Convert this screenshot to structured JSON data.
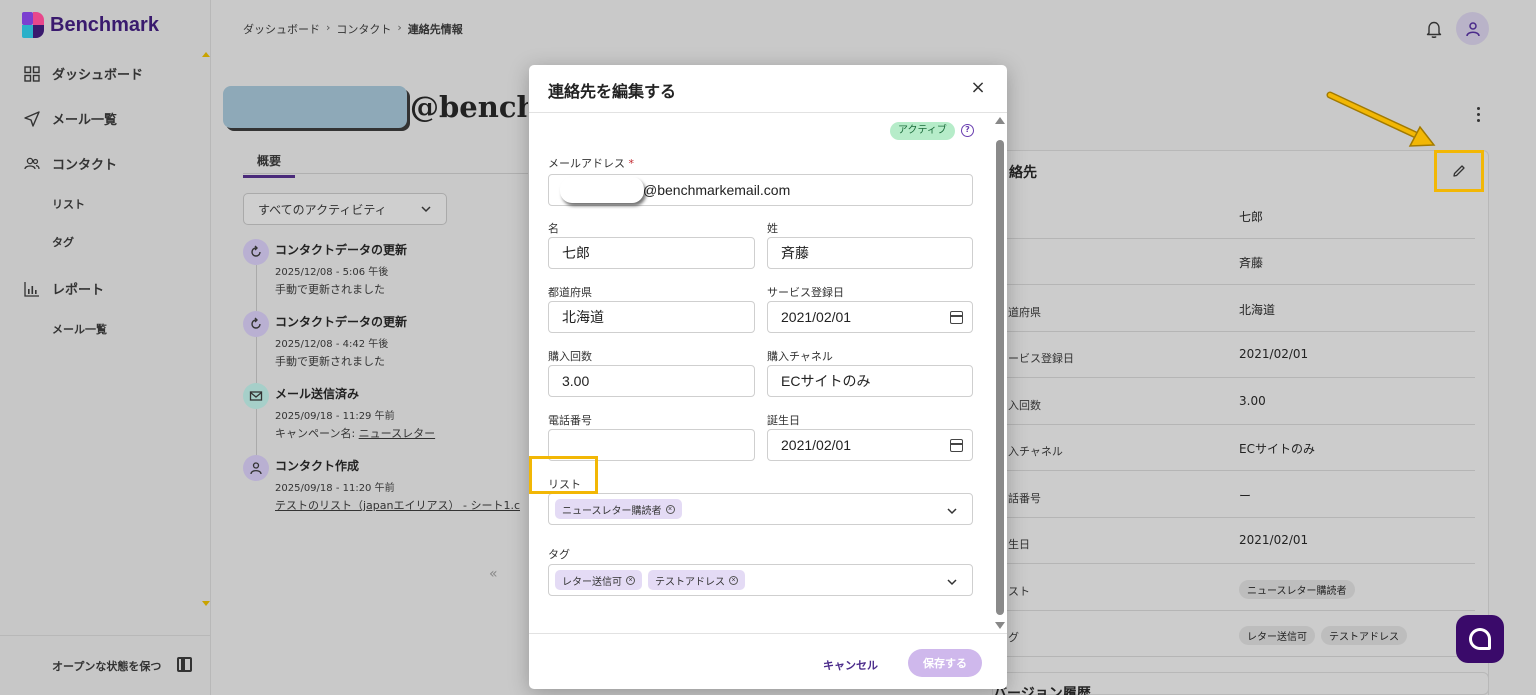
{
  "app": {
    "brand": "Benchmark"
  },
  "sidebar": {
    "items": [
      {
        "label": "ダッシュボード",
        "icon": "grid-icon"
      },
      {
        "label": "メール一覧",
        "icon": "send-icon"
      },
      {
        "label": "コンタクト",
        "icon": "users-icon"
      },
      {
        "label": "リスト"
      },
      {
        "label": "タグ"
      },
      {
        "label": "レポート",
        "icon": "bar-chart-icon"
      },
      {
        "label": "メール一覧"
      }
    ],
    "footer_label": "オープンな状態を保つ"
  },
  "breadcrumb": {
    "home": "ダッシュボード",
    "section": "コンタクト",
    "current": "連絡先情報"
  },
  "contact": {
    "heading": "@bench",
    "tab_overview": "概要",
    "activity_filter": "すべてのアクティビティ",
    "timeline": [
      {
        "title": "コンタクトデータの更新",
        "date": "2025/12/08 - 5:06 午後",
        "desc": "手動で更新されました",
        "icon": "refresh-icon"
      },
      {
        "title": "コンタクトデータの更新",
        "date": "2025/12/08 - 4:42 午後",
        "desc": "手動で更新されました",
        "icon": "refresh-icon"
      },
      {
        "title": "メール送信済み",
        "date": "2025/09/18 - 11:29 午前",
        "desc_prefix": "キャンペーン名: ",
        "desc_link": "ニュースレター",
        "icon": "mail-icon"
      },
      {
        "title": "コンタクト作成",
        "date": "2025/09/18 - 11:20 午前",
        "desc_link": "テストのリスト（japanエイリアス） - シート1.c",
        "icon": "user-icon"
      }
    ],
    "collapse_glyph": "«"
  },
  "details": {
    "title": "絡先",
    "rows": [
      {
        "label": "",
        "value": "七郎"
      },
      {
        "label": "",
        "value": "斉藤"
      },
      {
        "label": "道府県",
        "value": "北海道"
      },
      {
        "label": "ービス登録日",
        "value": "2021/02/01"
      },
      {
        "label": "入回数",
        "value": "3.00"
      },
      {
        "label": "入チャネル",
        "value": "ECサイトのみ"
      },
      {
        "label": "話番号",
        "value": "ー"
      },
      {
        "label": "生日",
        "value": "2021/02/01"
      },
      {
        "label": "スト",
        "chips": [
          "ニュースレター購読者"
        ]
      },
      {
        "label": "グ",
        "chips": [
          "レター送信可",
          "テストアドレス"
        ]
      }
    ],
    "version_title": "バージョン履歴"
  },
  "modal": {
    "title": "連絡先を編集する",
    "close": "×",
    "status": "アクティブ",
    "help": "?",
    "fields": {
      "email_label": "メールアドレス",
      "email_required": "*",
      "email_value": "@benchmarkemail.com",
      "first_name_label": "名",
      "first_name_value": "七郎",
      "last_name_label": "姓",
      "last_name_value": "斉藤",
      "prefecture_label": "都道府県",
      "prefecture_value": "北海道",
      "signup_date_label": "サービス登録日",
      "signup_date_value": "2021/02/01",
      "purchase_count_label": "購入回数",
      "purchase_count_value": "3.00",
      "purchase_channel_label": "購入チャネル",
      "purchase_channel_value": "ECサイトのみ",
      "phone_label": "電話番号",
      "phone_value": "",
      "birthday_label": "誕生日",
      "birthday_value": "2021/02/01",
      "list_label": "リスト",
      "list_chips": [
        "ニュースレター購読者"
      ],
      "tag_label": "タグ",
      "tag_chips": [
        "レター送信可",
        "テストアドレス"
      ]
    },
    "cancel": "キャンセル",
    "save": "保存する"
  },
  "colors": {
    "brand": "#3a1a6e",
    "accent": "#4a2a8a",
    "highlight": "#f2b705",
    "status_bg": "#b6ecc9",
    "chip_bg": "#e4dbf5"
  }
}
